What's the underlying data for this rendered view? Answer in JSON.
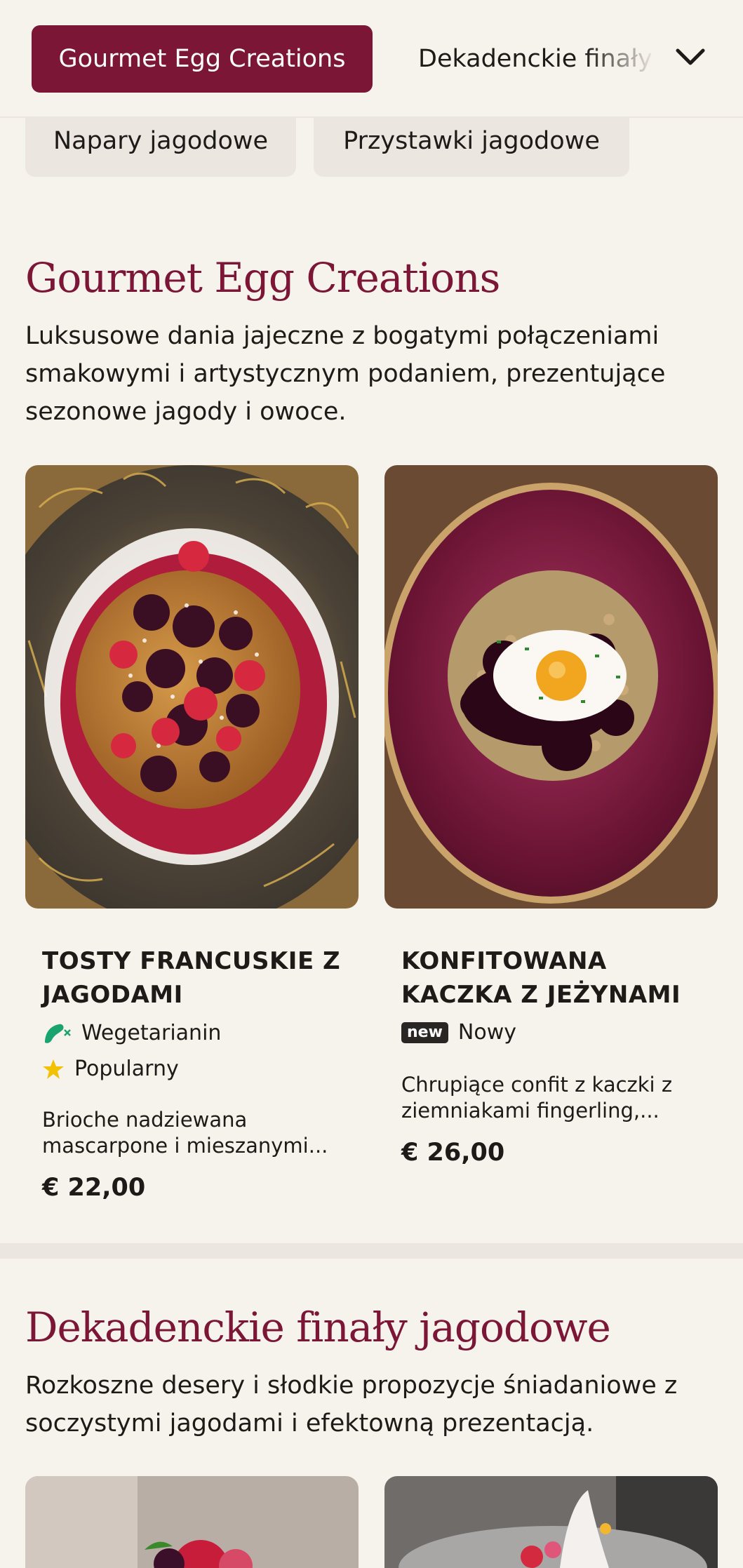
{
  "nav": {
    "active": "Gourmet Egg Creations",
    "next": "Dekadenckie finały jagodowe"
  },
  "categories": [
    "Napary jagodowe",
    "Przystawki jagodowe"
  ],
  "sections": [
    {
      "title": "Gourmet Egg Creations",
      "description": "Luksusowe dania jajeczne z bogatymi połączeniami smakowymi i artystycznym podaniem, prezentujące sezonowe jagody i owoce.",
      "items": [
        {
          "name": "TOSTY FRANCUSKIE Z JAGODAMI",
          "tags": [
            {
              "icon": "vegetarian-icon",
              "label": "Wegetarianin"
            },
            {
              "icon": "star-icon",
              "label": "Popularny"
            }
          ],
          "description": "Brioche nadziewana mascarpone i mieszanymi...",
          "price": "€ 22,00"
        },
        {
          "name": "KONFITOWANA KACZKA Z JEŻYNAMI",
          "tags": [
            {
              "icon": "new-badge",
              "badge": "new",
              "label": "Nowy"
            }
          ],
          "description": "Chrupiące confit z kaczki z ziemniakami fingerling,...",
          "price": "€ 26,00"
        }
      ]
    },
    {
      "title": "Dekadenckie finały jagodowe",
      "description": "Rozkoszne desery i słodkie propozycje śniadaniowe z soczystymi jagodami i efektowną prezentacją."
    }
  ],
  "colors": {
    "accent": "#7b1637",
    "background": "#f6f2ec",
    "pill": "#ece6e1",
    "vegetarian": "#1aa36f",
    "star": "#f2c200"
  }
}
